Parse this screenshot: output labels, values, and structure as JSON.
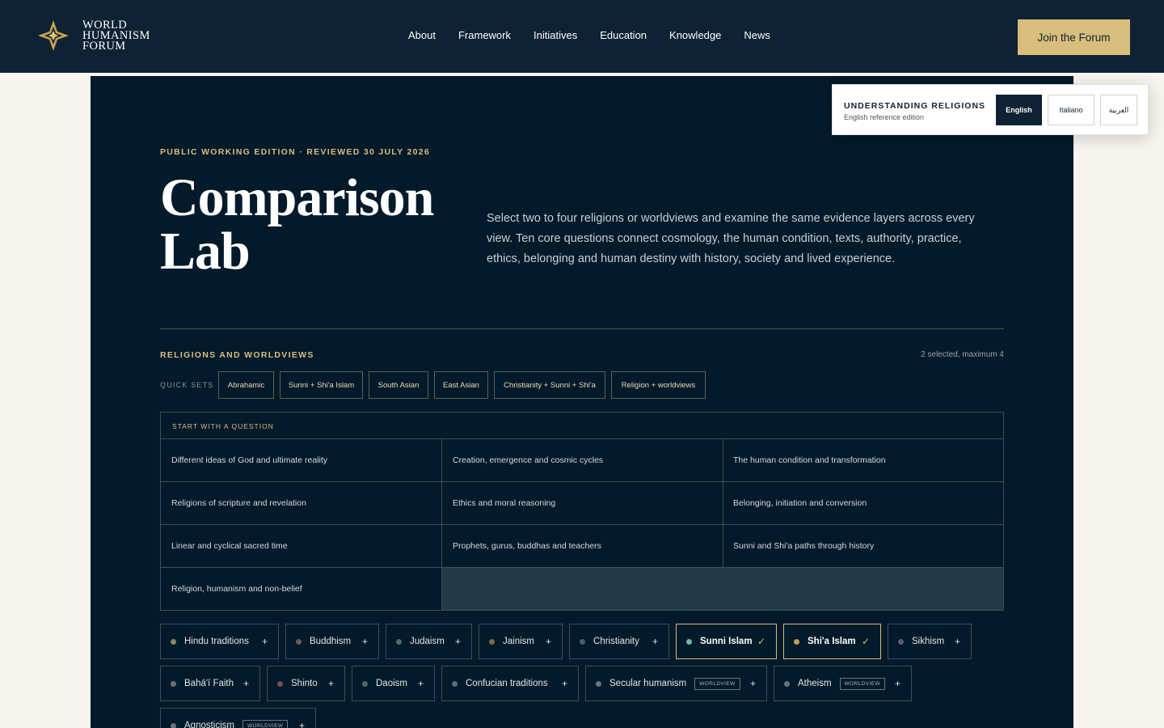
{
  "header": {
    "logo_lines": [
      "WORLD",
      "HUMANISM",
      "FORUM"
    ],
    "nav": [
      "About",
      "Framework",
      "Initiatives",
      "Education",
      "Knowledge",
      "News"
    ],
    "cta": "Join the Forum"
  },
  "language": {
    "title": "UNDERSTANDING RELIGIONS",
    "subtitle": "English reference edition",
    "options": [
      "English",
      "Italiano",
      "العربية"
    ],
    "selected": "English"
  },
  "hero": {
    "eyebrow": "PUBLIC WORKING EDITION · REVIEWED 30 JULY 2026",
    "title": "Comparison Lab",
    "intro": "Select two to four religions or worldviews and examine the same evidence layers across every view. Ten core questions connect cosmology, the human condition, texts, authority, practice, ethics, belonging and human destiny with history, society and lived experience."
  },
  "religions_section": {
    "title": "RELIGIONS AND WORLDVIEWS",
    "selection_status": "2 selected, maximum 4",
    "quick_sets_label": "QUICK SETS",
    "quick_sets": [
      "Abrahamic",
      "Sunni + Shi'a Islam",
      "South Asian",
      "East Asian",
      "Christianity + Sunni + Shi'a",
      "Religion + worldviews"
    ]
  },
  "questions": {
    "heading": "START WITH A QUESTION",
    "items": [
      "Different ideas of God and ultimate reality",
      "Creation, emergence and cosmic cycles",
      "The human condition and transformation",
      "Religions of scripture and revelation",
      "Ethics and moral reasoning",
      "Belonging, initiation and conversion",
      "Linear and cyclical sacred time",
      "Prophets, gurus, buddhas and teachers",
      "Sunni and Shi'a paths through history",
      "Religion, humanism and non-belief"
    ]
  },
  "religions": [
    {
      "name": "Hindu traditions",
      "dot": "#8d8a5b",
      "selected": false,
      "tag": ""
    },
    {
      "name": "Buddhism",
      "dot": "#6b5a52",
      "selected": false,
      "tag": ""
    },
    {
      "name": "Judaism",
      "dot": "#4b6a68",
      "selected": false,
      "tag": ""
    },
    {
      "name": "Jainism",
      "dot": "#7a6c47",
      "selected": false,
      "tag": ""
    },
    {
      "name": "Christianity",
      "dot": "#4c5d73",
      "selected": false,
      "tag": ""
    },
    {
      "name": "Sunni Islam",
      "dot": "#6fb5a3",
      "selected": true,
      "tag": ""
    },
    {
      "name": "Shi'a Islam",
      "dot": "#c29b5a",
      "selected": true,
      "tag": ""
    },
    {
      "name": "Sikhism",
      "dot": "#5d5a84",
      "selected": false,
      "tag": ""
    },
    {
      "name": "Bahá'í Faith",
      "dot": "#6c6f77",
      "selected": false,
      "tag": ""
    },
    {
      "name": "Shinto",
      "dot": "#7a4c55",
      "selected": false,
      "tag": ""
    },
    {
      "name": "Daoism",
      "dot": "#4f6b57",
      "selected": false,
      "tag": ""
    },
    {
      "name": "Confucian traditions",
      "dot": "#5b6e80",
      "selected": false,
      "tag": ""
    },
    {
      "name": "Secular humanism",
      "dot": "#69727c",
      "selected": false,
      "tag": "WORLDVIEW"
    },
    {
      "name": "Atheism",
      "dot": "#69727c",
      "selected": false,
      "tag": "WORLDVIEW"
    },
    {
      "name": "Agnosticism",
      "dot": "#69727c",
      "selected": false,
      "tag": "WORLDVIEW"
    }
  ],
  "icons": {
    "logo": "compass-star-icon",
    "add": "plus-icon",
    "selected": "check-icon"
  },
  "colors": {
    "navy": "#0e2233",
    "panel": "#021a2a",
    "gold": "#d9bd7c",
    "cream": "#f7f4ee"
  }
}
